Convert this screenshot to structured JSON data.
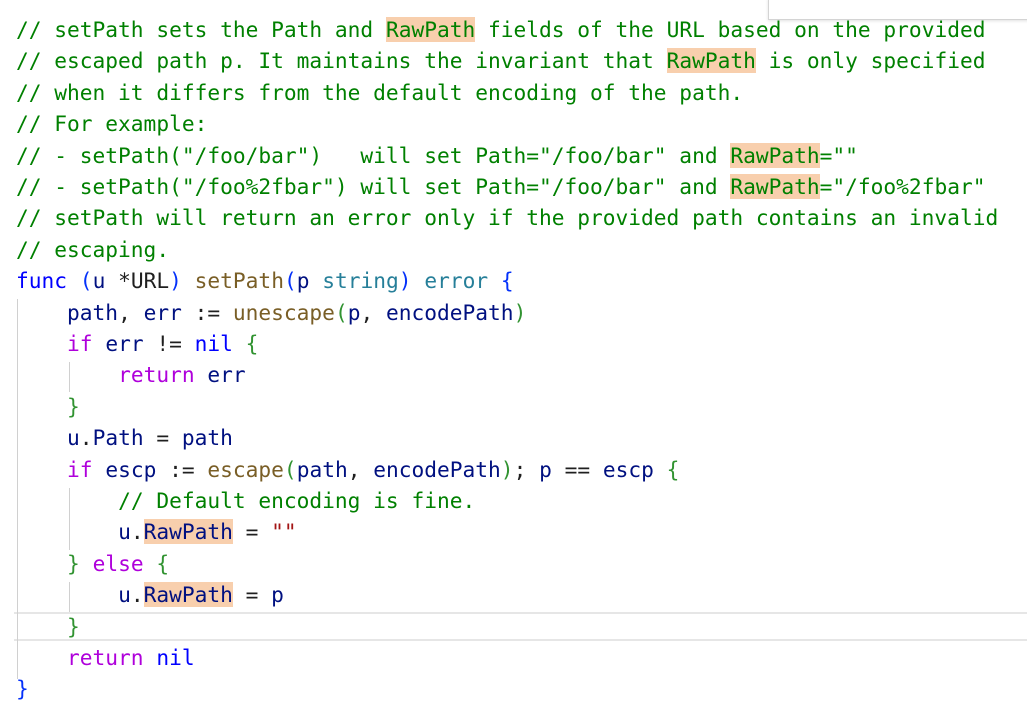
{
  "editor": {
    "highlight_term": "RawPath",
    "lines": [
      {
        "id": "l1",
        "segments": [
          {
            "cls": "c",
            "t": "// setPath sets the Path and "
          },
          {
            "cls": "c hl",
            "t": "RawPath"
          },
          {
            "cls": "c",
            "t": " fields of the URL based on the provided"
          }
        ]
      },
      {
        "id": "l2",
        "segments": [
          {
            "cls": "c",
            "t": "// escaped path p. It maintains the invariant that "
          },
          {
            "cls": "c hl",
            "t": "RawPath"
          },
          {
            "cls": "c",
            "t": " is only specified"
          }
        ]
      },
      {
        "id": "l3",
        "segments": [
          {
            "cls": "c",
            "t": "// when it differs from the default encoding of the path."
          }
        ]
      },
      {
        "id": "l4",
        "segments": [
          {
            "cls": "c",
            "t": "// For example:"
          }
        ]
      },
      {
        "id": "l5",
        "segments": [
          {
            "cls": "c",
            "t": "// - setPath(\"/foo/bar\")   will set Path=\"/foo/bar\" and "
          },
          {
            "cls": "c hl",
            "t": "RawPath"
          },
          {
            "cls": "c",
            "t": "=\"\""
          }
        ]
      },
      {
        "id": "l6",
        "segments": [
          {
            "cls": "c",
            "t": "// - setPath(\"/foo%2fbar\") will set Path=\"/foo/bar\" and "
          },
          {
            "cls": "c hl",
            "t": "RawPath"
          },
          {
            "cls": "c",
            "t": "=\"/foo%2fbar\""
          }
        ]
      },
      {
        "id": "l7",
        "segments": [
          {
            "cls": "c",
            "t": "// setPath will return an error only if the provided path contains an invalid"
          }
        ]
      },
      {
        "id": "l8",
        "segments": [
          {
            "cls": "c",
            "t": "// escaping."
          }
        ]
      },
      {
        "id": "l9",
        "segments": [
          {
            "cls": "k",
            "t": "func"
          },
          {
            "cls": "p",
            "t": " "
          },
          {
            "cls": "b1",
            "t": "("
          },
          {
            "cls": "v",
            "t": "u"
          },
          {
            "cls": "p",
            "t": " *"
          },
          {
            "cls": "p",
            "t": "URL"
          },
          {
            "cls": "b1",
            "t": ")"
          },
          {
            "cls": "p",
            "t": " "
          },
          {
            "cls": "f",
            "t": "setPath"
          },
          {
            "cls": "b1",
            "t": "("
          },
          {
            "cls": "v",
            "t": "p"
          },
          {
            "cls": "p",
            "t": " "
          },
          {
            "cls": "t",
            "t": "string"
          },
          {
            "cls": "b1",
            "t": ")"
          },
          {
            "cls": "p",
            "t": " "
          },
          {
            "cls": "t",
            "t": "error"
          },
          {
            "cls": "p",
            "t": " "
          },
          {
            "cls": "b1",
            "t": "{"
          }
        ]
      },
      {
        "id": "l10",
        "segments": [
          {
            "cls": "p",
            "t": "    "
          },
          {
            "cls": "v",
            "t": "path"
          },
          {
            "cls": "p",
            "t": ", "
          },
          {
            "cls": "v",
            "t": "err"
          },
          {
            "cls": "p",
            "t": " := "
          },
          {
            "cls": "f",
            "t": "unescape"
          },
          {
            "cls": "b2",
            "t": "("
          },
          {
            "cls": "v",
            "t": "p"
          },
          {
            "cls": "p",
            "t": ", "
          },
          {
            "cls": "v",
            "t": "encodePath"
          },
          {
            "cls": "b2",
            "t": ")"
          }
        ]
      },
      {
        "id": "l11",
        "segments": [
          {
            "cls": "p",
            "t": "    "
          },
          {
            "cls": "kp",
            "t": "if"
          },
          {
            "cls": "p",
            "t": " "
          },
          {
            "cls": "v",
            "t": "err"
          },
          {
            "cls": "p",
            "t": " != "
          },
          {
            "cls": "k",
            "t": "nil"
          },
          {
            "cls": "p",
            "t": " "
          },
          {
            "cls": "b2",
            "t": "{"
          }
        ]
      },
      {
        "id": "l12",
        "segments": [
          {
            "cls": "p",
            "t": "        "
          },
          {
            "cls": "kp",
            "t": "return"
          },
          {
            "cls": "p",
            "t": " "
          },
          {
            "cls": "v",
            "t": "err"
          }
        ]
      },
      {
        "id": "l13",
        "segments": [
          {
            "cls": "p",
            "t": "    "
          },
          {
            "cls": "b2",
            "t": "}"
          }
        ]
      },
      {
        "id": "l14",
        "segments": [
          {
            "cls": "p",
            "t": "    "
          },
          {
            "cls": "v",
            "t": "u"
          },
          {
            "cls": "p",
            "t": "."
          },
          {
            "cls": "v",
            "t": "Path"
          },
          {
            "cls": "p",
            "t": " = "
          },
          {
            "cls": "v",
            "t": "path"
          }
        ]
      },
      {
        "id": "l15",
        "segments": [
          {
            "cls": "p",
            "t": "    "
          },
          {
            "cls": "kp",
            "t": "if"
          },
          {
            "cls": "p",
            "t": " "
          },
          {
            "cls": "v",
            "t": "escp"
          },
          {
            "cls": "p",
            "t": " := "
          },
          {
            "cls": "f",
            "t": "escape"
          },
          {
            "cls": "b2",
            "t": "("
          },
          {
            "cls": "v",
            "t": "path"
          },
          {
            "cls": "p",
            "t": ", "
          },
          {
            "cls": "v",
            "t": "encodePath"
          },
          {
            "cls": "b2",
            "t": ")"
          },
          {
            "cls": "p",
            "t": "; "
          },
          {
            "cls": "v",
            "t": "p"
          },
          {
            "cls": "p",
            "t": " == "
          },
          {
            "cls": "v",
            "t": "escp"
          },
          {
            "cls": "p",
            "t": " "
          },
          {
            "cls": "b2",
            "t": "{"
          }
        ]
      },
      {
        "id": "l16",
        "segments": [
          {
            "cls": "p",
            "t": "        "
          },
          {
            "cls": "c",
            "t": "// Default encoding is fine."
          }
        ]
      },
      {
        "id": "l17",
        "segments": [
          {
            "cls": "p",
            "t": "        "
          },
          {
            "cls": "v",
            "t": "u"
          },
          {
            "cls": "p",
            "t": "."
          },
          {
            "cls": "v hl",
            "t": "RawPath"
          },
          {
            "cls": "p",
            "t": " = "
          },
          {
            "cls": "s",
            "t": "\"\""
          }
        ]
      },
      {
        "id": "l18",
        "segments": [
          {
            "cls": "p",
            "t": "    "
          },
          {
            "cls": "b2",
            "t": "}"
          },
          {
            "cls": "p",
            "t": " "
          },
          {
            "cls": "kp",
            "t": "else"
          },
          {
            "cls": "p",
            "t": " "
          },
          {
            "cls": "b2",
            "t": "{"
          }
        ]
      },
      {
        "id": "l19",
        "segments": [
          {
            "cls": "p",
            "t": "        "
          },
          {
            "cls": "v",
            "t": "u"
          },
          {
            "cls": "p",
            "t": "."
          },
          {
            "cls": "v hl",
            "t": "RawPath"
          },
          {
            "cls": "p",
            "t": " = "
          },
          {
            "cls": "v",
            "t": "p"
          }
        ]
      },
      {
        "id": "l20",
        "segments": [
          {
            "cls": "p",
            "t": "    "
          },
          {
            "cls": "b2",
            "t": "}"
          }
        ]
      },
      {
        "id": "l21",
        "segments": [
          {
            "cls": "p",
            "t": "    "
          },
          {
            "cls": "kp",
            "t": "return"
          },
          {
            "cls": "p",
            "t": " "
          },
          {
            "cls": "k",
            "t": "nil"
          }
        ]
      },
      {
        "id": "l22",
        "segments": [
          {
            "cls": "b1",
            "t": "}"
          }
        ]
      }
    ]
  },
  "colors": {
    "comment": "#008000",
    "keyword": "#0000ff",
    "control_keyword": "#af00db",
    "function": "#795e26",
    "variable": "#001080",
    "type": "#267f99",
    "string": "#a31515",
    "find_highlight": "#f8cfad"
  }
}
